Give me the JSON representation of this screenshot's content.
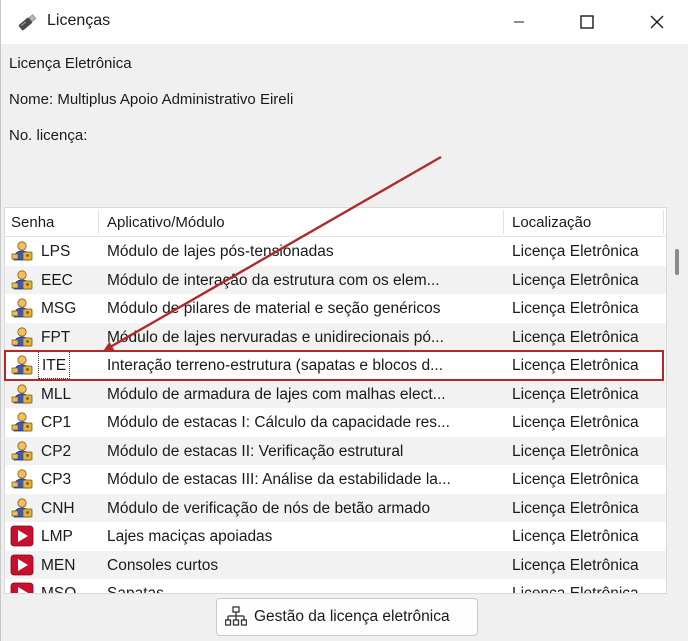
{
  "window": {
    "title": "Licenças"
  },
  "info": {
    "heading": "Licença Eletrônica",
    "name_line": "Nome: Multiplus Apoio Administrativo Eireli",
    "license_line": "No. licença:"
  },
  "table": {
    "headers": {
      "password": "Senha",
      "module": "Aplicativo/Módulo",
      "location": "Localização"
    },
    "rows": [
      {
        "code": "LPS",
        "module": "Módulo de lajes pós-tensionadas",
        "location": "Licença Eletrônica",
        "icon": "key-user-icon"
      },
      {
        "code": "EEC",
        "module": "Módulo de interação da estrutura com os elem...",
        "location": "Licença Eletrônica",
        "icon": "key-user-icon"
      },
      {
        "code": "MSG",
        "module": "Módulo de pilares de material e seção genéricos",
        "location": "Licença Eletrônica",
        "icon": "key-user-icon"
      },
      {
        "code": "FPT",
        "module": "Módulo de lajes nervuradas e unidirecionais pó...",
        "location": "Licença Eletrônica",
        "icon": "key-user-icon"
      },
      {
        "code": "ITE",
        "module": "Interação terreno-estrutura (sapatas e blocos d...",
        "location": "Licença Eletrônica",
        "icon": "key-user-icon",
        "selected": true
      },
      {
        "code": "MLL",
        "module": "Módulo de armadura de lajes com malhas elect...",
        "location": "Licença Eletrônica",
        "icon": "key-user-icon"
      },
      {
        "code": "CP1",
        "module": "Módulo de estacas I: Cálculo da capacidade res...",
        "location": "Licença Eletrônica",
        "icon": "key-user-icon"
      },
      {
        "code": "CP2",
        "module": "Módulo de estacas II: Verificação estrutural",
        "location": "Licença Eletrônica",
        "icon": "key-user-icon"
      },
      {
        "code": "CP3",
        "module": "Módulo de estacas III: Análise da estabilidade la...",
        "location": "Licença Eletrônica",
        "icon": "key-user-icon"
      },
      {
        "code": "CNH",
        "module": "Módulo de verificação de nós de betão armado",
        "location": "Licença Eletrônica",
        "icon": "key-user-icon"
      },
      {
        "code": "LMP",
        "module": "Lajes maciças apoiadas",
        "location": "Licença Eletrônica",
        "icon": "play-icon"
      },
      {
        "code": "MEN",
        "module": "Consoles curtos",
        "location": "Licença Eletrônica",
        "icon": "play-icon"
      },
      {
        "code": "MSO",
        "module": "Sapatas",
        "location": "Licença Eletrônica",
        "icon": "play-icon"
      }
    ]
  },
  "footer": {
    "manage_button": "Gestão da licença eletrônica"
  },
  "colors": {
    "annotation_red": "#b02a2a",
    "play_icon_red": "#c8102e"
  }
}
